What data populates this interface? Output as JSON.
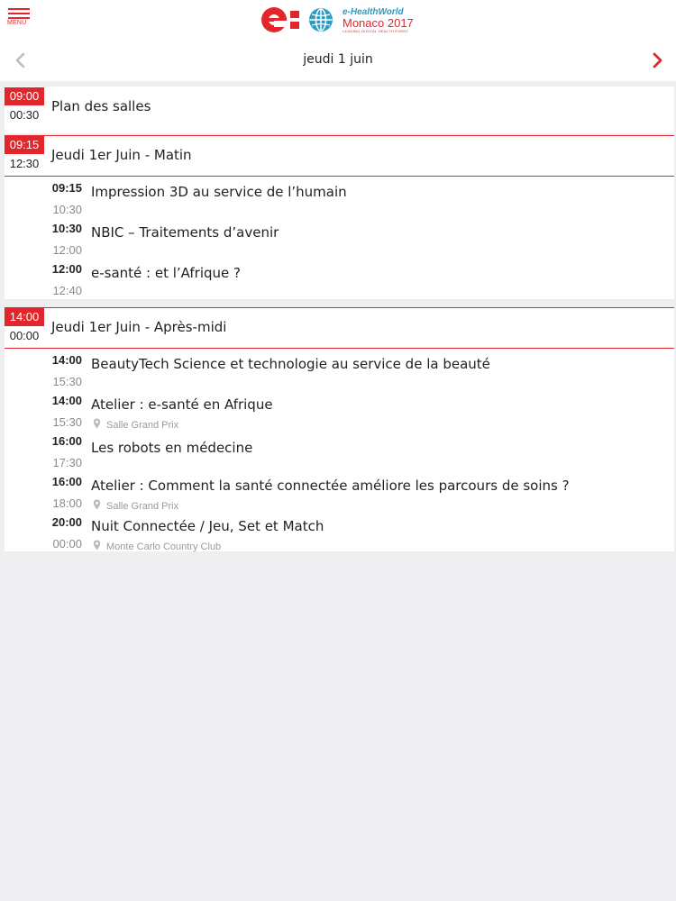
{
  "header": {
    "menu_label": "MENU",
    "logo": {
      "line1": "e-HealthWorld",
      "line2": "Monaco 2017",
      "line3": "LEADING DIGITAL HEALTH EVENT"
    },
    "accent_color": "#e3262b",
    "icons": [
      "menu-icon",
      "e-logo",
      "globe-icon"
    ]
  },
  "datebar": {
    "title": "jeudi 1 juin",
    "prev_icon": "chevron-left-icon",
    "next_icon": "chevron-right-icon"
  },
  "sessions": [
    {
      "start": "09:00",
      "end": "00:30",
      "title": "Plan des salles",
      "items": []
    },
    {
      "start": "09:15",
      "end": "12:30",
      "title": "Jeudi 1er Juin - Matin",
      "items": [
        {
          "start": "09:15",
          "end": "10:30",
          "title": "Impression 3D au service de l’humain",
          "location": ""
        },
        {
          "start": "10:30",
          "end": "12:00",
          "title": "NBIC – Traitements d’avenir",
          "location": ""
        },
        {
          "start": "12:00",
          "end": "12:40",
          "title": "e-santé : et l’Afrique ?",
          "location": ""
        }
      ]
    },
    {
      "start": "14:00",
      "end": "00:00",
      "title": "Jeudi 1er Juin - Après-midi",
      "items": [
        {
          "start": "14:00",
          "end": "15:30",
          "title": "BeautyTech Science et technologie au service de la beauté",
          "location": ""
        },
        {
          "start": "14:00",
          "end": "15:30",
          "title": "Atelier : e-santé en Afrique",
          "location": "Salle Grand Prix"
        },
        {
          "start": "16:00",
          "end": "17:30",
          "title": "Les robots en médecine",
          "location": ""
        },
        {
          "start": "16:00",
          "end": "18:00",
          "title": "Atelier : Comment la santé connectée améliore les parcours de soins ?",
          "location": "Salle Grand Prix"
        },
        {
          "start": "20:00",
          "end": "00:00",
          "title": "Nuit Connectée / Jeu, Set et Match",
          "location": "Monte Carlo Country Club"
        }
      ]
    }
  ]
}
